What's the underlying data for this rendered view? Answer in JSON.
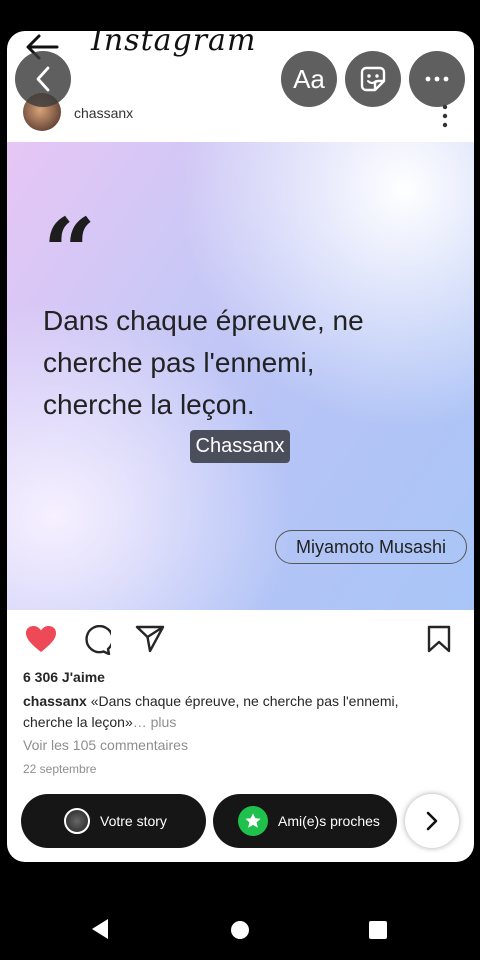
{
  "instagram": {
    "logo_text": "Instagram",
    "username": "chassanx"
  },
  "post": {
    "quote_mark": "“",
    "quote_line1": "Dans chaque épreuve, ne",
    "quote_line2": "cherche pas l'ennemi,",
    "quote_line3": "cherche la leçon.",
    "author": "Miyamoto Musashi",
    "watermark": "Chassanx",
    "like_color": "#ed4956"
  },
  "meta": {
    "likes": "6 306 J'aime",
    "caption_user": "chassanx",
    "caption_text": " «Dans chaque épreuve, ne cherche pas l'ennemi, cherche la leçon»",
    "caption_more": "… plus",
    "comments": "Voir les 105 commentaires",
    "date": "22 septembre"
  },
  "story_editor": {
    "text_tool_label": "Aa",
    "your_story_label": "Votre story",
    "close_friends_label": "Ami(e)s proches",
    "close_friends_color": "#1fc04b"
  },
  "icons": [
    "back-arrow-icon",
    "chevron-left-icon",
    "text-tool",
    "sticker-icon",
    "more-icon",
    "kebab-icon",
    "heart-icon",
    "comment-icon",
    "send-icon",
    "bookmark-icon",
    "star-icon",
    "chevron-right-icon",
    "nav-back-icon",
    "nav-home-icon",
    "nav-recents-icon"
  ]
}
